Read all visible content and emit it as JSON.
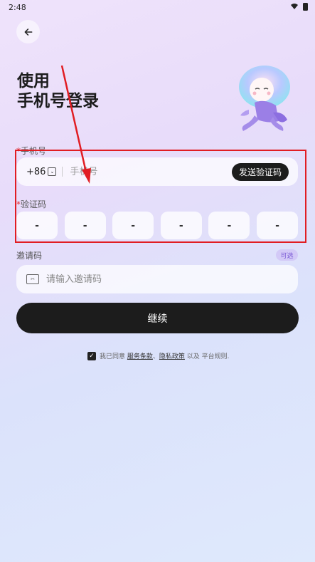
{
  "status_bar": {
    "time": "2:48"
  },
  "title": {
    "line1": "使用",
    "line2": "手机号登录"
  },
  "phone": {
    "label": "手机号",
    "country_code": "+86",
    "placeholder": "手机号",
    "send_code_label": "发送验证码"
  },
  "verification": {
    "label": "验证码",
    "digits": [
      "-",
      "-",
      "-",
      "-",
      "-",
      "-"
    ]
  },
  "invite": {
    "label": "邀请码",
    "optional_badge": "可选",
    "placeholder": "请输入邀请码"
  },
  "continue_label": "继续",
  "agreement": {
    "prefix": "我已同意",
    "terms": "服务条款",
    "separator": "、",
    "privacy": "隐私政策",
    "middle": " 以及 ",
    "suffix": "平台规则."
  },
  "colors": {
    "annotation": "#e11d23",
    "primary_button": "#1c1c1c",
    "accent": "#7b5cd6"
  }
}
